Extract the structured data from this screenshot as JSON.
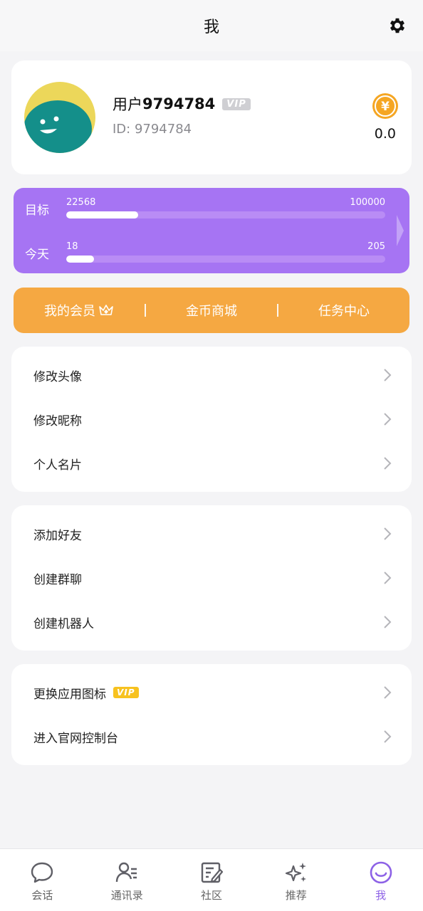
{
  "header": {
    "title": "我"
  },
  "profile": {
    "name_prefix": "用户",
    "name_number": "9794784",
    "vip_badge": "VIP",
    "id_text": "ID: 9794784",
    "coin_symbol": "¥",
    "coin_value": "0.0"
  },
  "goal": {
    "target_label": "目标",
    "target_current": "22568",
    "target_max": "100000",
    "target_progress": 0.2257,
    "today_label": "今天",
    "today_current": "18",
    "today_max": "205",
    "today_progress": 0.0878
  },
  "membar": {
    "member": "我的会员",
    "shop": "金币商城",
    "task": "任务中心"
  },
  "group1": [
    "修改头像",
    "修改昵称",
    "个人名片"
  ],
  "group2": [
    "添加好友",
    "创建群聊",
    "创建机器人"
  ],
  "group3": {
    "change_icon": "更换应用图标",
    "vip_badge": "VIP",
    "console": "进入官网控制台"
  },
  "tabs": {
    "chat": "会话",
    "contacts": "通讯录",
    "community": "社区",
    "recommend": "推荐",
    "me": "我"
  },
  "colors": {
    "accent_purple": "#a674f3",
    "orange": "#f5a842",
    "coin_gold": "#f5a623",
    "active_tab": "#8d62e6"
  }
}
